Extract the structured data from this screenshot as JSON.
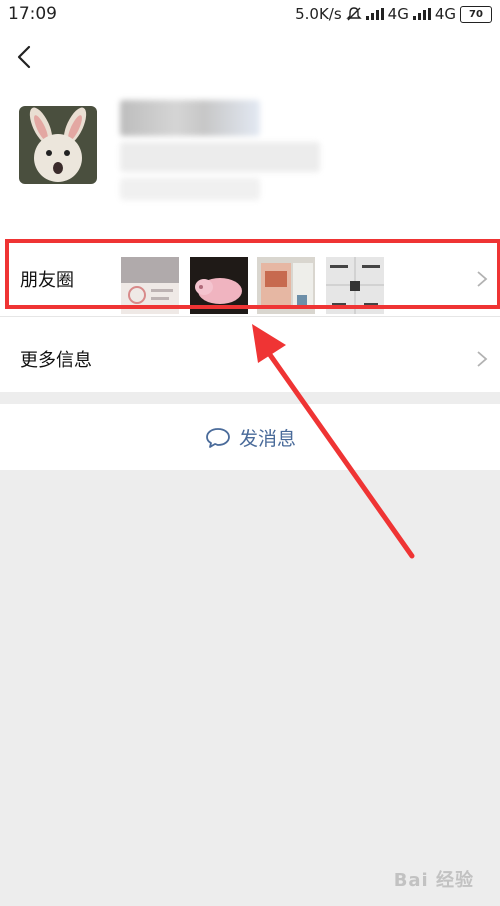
{
  "status_bar": {
    "time": "17:09",
    "net_speed": "5.0K/s",
    "network_1": "4G",
    "network_2": "4G",
    "battery": "70"
  },
  "nav": {
    "back_icon": "chevron-left-icon"
  },
  "profile": {
    "avatar": "rabbit-photo-avatar",
    "name_hidden": true
  },
  "moments": {
    "label": "朋友圈",
    "thumbnails": [
      {
        "name": "moments-thumb-certificate"
      },
      {
        "name": "moments-thumb-pink-pig-toy"
      },
      {
        "name": "moments-thumb-document"
      },
      {
        "name": "moments-thumb-poster"
      }
    ]
  },
  "more_info": {
    "label": "更多信息"
  },
  "actions": {
    "send_message_label": "发消息",
    "send_icon": "chat-bubble-icon"
  },
  "annotation": {
    "highlight_color": "#ef3434",
    "arrow_color": "#ef3434"
  },
  "watermark": {
    "text": "Bai 经验"
  },
  "colors": {
    "link_blue": "#4a6b9a",
    "background": "#ededed"
  }
}
